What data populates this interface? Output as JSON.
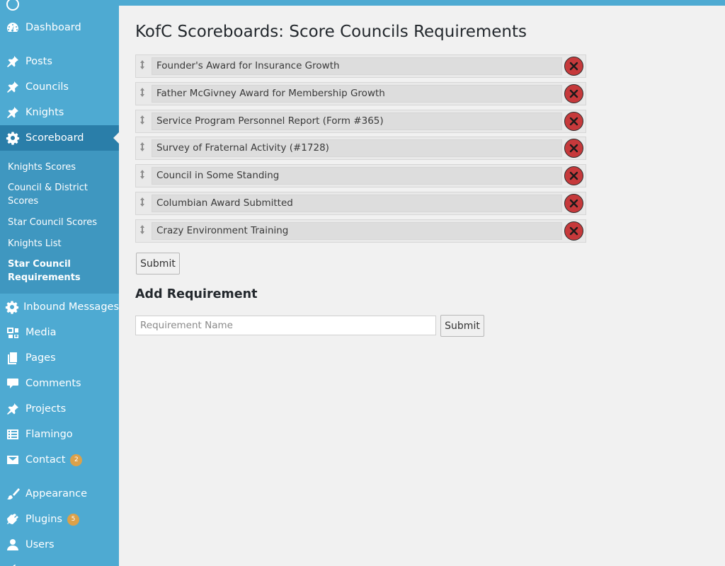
{
  "colors": {
    "sidebar": "#4eaad2",
    "sidebar_current": "#2a7ea9",
    "submenu": "#3f97c0",
    "delete": "#c6393b",
    "badge": "#dba14a"
  },
  "sidebar": {
    "items": [
      {
        "label": "Dashboard",
        "icon": "dashboard-icon"
      },
      {
        "label": "Posts",
        "icon": "pin-icon"
      },
      {
        "label": "Councils",
        "icon": "pin-icon"
      },
      {
        "label": "Knights",
        "icon": "pin-icon"
      },
      {
        "label": "Scoreboard",
        "icon": "gear-icon"
      },
      {
        "label": "Inbound Messages",
        "icon": "gear-icon"
      },
      {
        "label": "Media",
        "icon": "media-icon"
      },
      {
        "label": "Pages",
        "icon": "pages-icon"
      },
      {
        "label": "Comments",
        "icon": "comment-icon"
      },
      {
        "label": "Projects",
        "icon": "pin-icon"
      },
      {
        "label": "Flamingo",
        "icon": "list-icon"
      },
      {
        "label": "Contact",
        "icon": "mail-icon",
        "badge": "2"
      },
      {
        "label": "Appearance",
        "icon": "brush-icon"
      },
      {
        "label": "Plugins",
        "icon": "plugin-icon",
        "badge": "5"
      },
      {
        "label": "Users",
        "icon": "user-icon"
      }
    ],
    "submenu": [
      {
        "label": "Knights Scores"
      },
      {
        "label": "Council & District Scores"
      },
      {
        "label": "Star Council Scores"
      },
      {
        "label": "Knights List"
      },
      {
        "label": "Star Council Requirements"
      }
    ]
  },
  "page": {
    "title": "KofC Scoreboards: Score Councils Requirements",
    "requirements": [
      "Founder's Award for Insurance Growth",
      "Father McGivney Award for Membership Growth",
      "Service Program Personnel Report (Form #365)",
      "Survey of Fraternal Activity (#1728)",
      "Council in Some Standing",
      "Columbian Award Submitted",
      "Crazy Environment Training"
    ],
    "submit_label": "Submit",
    "add_heading": "Add Requirement",
    "add_placeholder": "Requirement Name",
    "add_submit_label": "Submit"
  }
}
